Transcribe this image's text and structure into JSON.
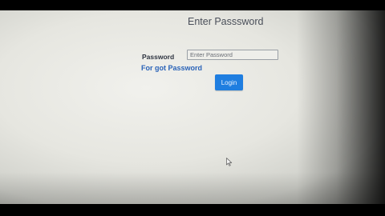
{
  "login_form": {
    "title": "Enter Passsword",
    "password_label": "Password",
    "password_placeholder": "Enter Password",
    "forgot_link": "For got Password",
    "login_button": "Login"
  },
  "icons": {
    "pointer": "mouse-pointer-icon"
  },
  "colors": {
    "accent": "#1f7ee0",
    "link": "#2a63b8",
    "label": "#2e3440"
  }
}
